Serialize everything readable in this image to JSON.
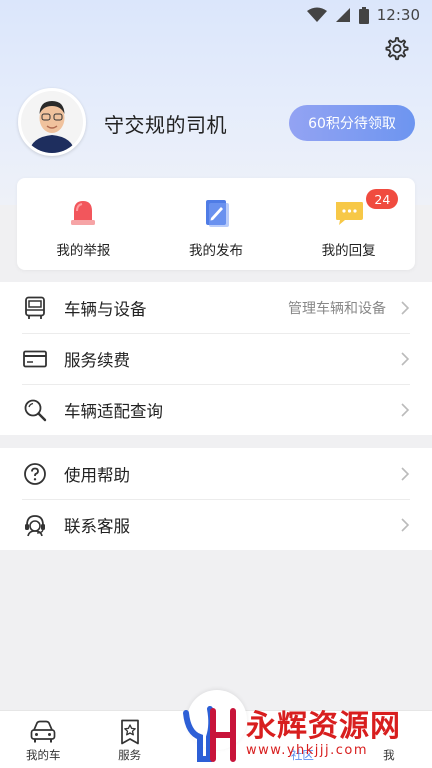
{
  "status": {
    "time": "12:30"
  },
  "profile": {
    "username": "守交规的司机",
    "points_button": "60积分待领取"
  },
  "quick_actions": [
    {
      "label": "我的举报",
      "icon": "alarm-light-icon"
    },
    {
      "label": "我的发布",
      "icon": "edit-document-icon"
    },
    {
      "label": "我的回复",
      "icon": "chat-bubble-icon",
      "badge": "24"
    }
  ],
  "menu_group_1": [
    {
      "label": "车辆与设备",
      "sub": "管理车辆和设备",
      "icon": "bus-icon"
    },
    {
      "label": "服务续费",
      "icon": "card-icon"
    },
    {
      "label": "车辆适配查询",
      "icon": "search-icon"
    }
  ],
  "menu_group_2": [
    {
      "label": "使用帮助",
      "icon": "help-icon"
    },
    {
      "label": "联系客服",
      "icon": "customer-service-icon"
    }
  ],
  "tabbar": {
    "tabs": [
      {
        "label": "我的车"
      },
      {
        "label": "服务"
      },
      {
        "label": ""
      },
      {
        "label": "社区"
      },
      {
        "label": "我"
      }
    ]
  },
  "watermark": {
    "brand": "永辉资源网",
    "url": "www.yhkjjj.com"
  },
  "colors": {
    "accent": "#6d95f0",
    "badge": "#f04b3f",
    "watermark": "#d81e1e"
  }
}
